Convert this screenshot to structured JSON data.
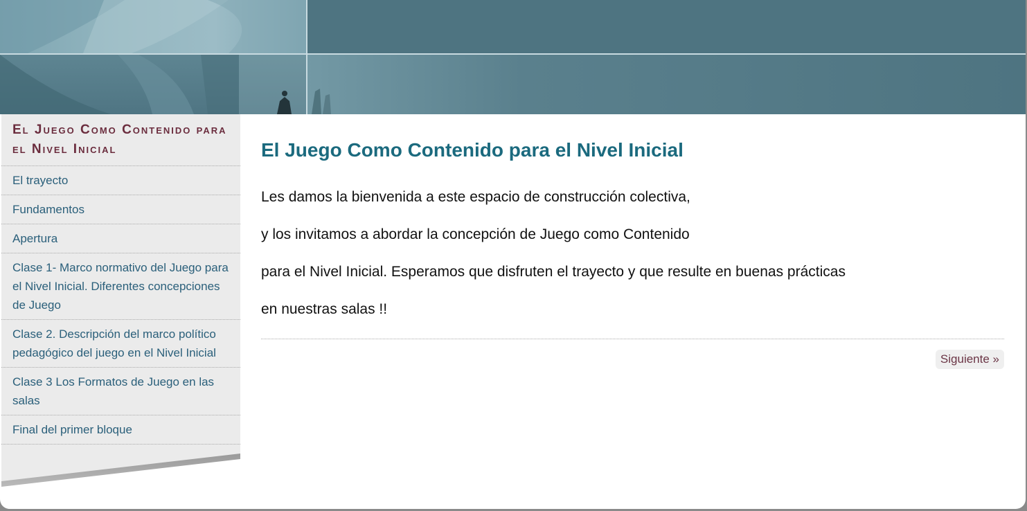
{
  "sidebar": {
    "title": "El Juego Como Contenido para el Nivel Inicial",
    "items": [
      {
        "label": "El trayecto"
      },
      {
        "label": "Fundamentos"
      },
      {
        "label": "Apertura"
      },
      {
        "label": "Clase 1- Marco normativo del Juego para el Nivel Inicial. Diferentes concepciones de Juego"
      },
      {
        "label": "Clase 2. Descripción del marco político pedagógico del juego en el Nivel Inicial"
      },
      {
        "label": "Clase 3 Los Formatos de Juego en las salas"
      },
      {
        "label": "Final del primer bloque"
      }
    ]
  },
  "main": {
    "title": "El Juego Como Contenido para el Nivel Inicial",
    "paragraphs": [
      "Les damos la bienvenida a este espacio de construcción colectiva,",
      "y los invitamos a abordar la concepción de Juego como Contenido",
      "para el Nivel Inicial. Esperamos que disfruten el trayecto y que resulte en buenas prácticas",
      "en nuestras salas !!"
    ],
    "next_label": "Siguiente »"
  },
  "colors": {
    "banner": "#4e7481",
    "sidebar_title": "#6b2d3e",
    "sidebar_link": "#2a5f7a",
    "main_title": "#1b6a7e"
  }
}
